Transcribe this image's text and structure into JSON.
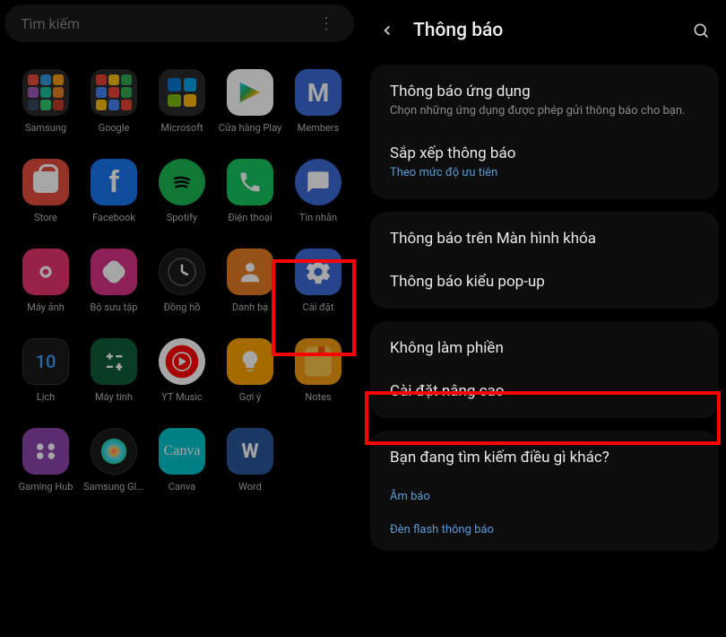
{
  "left": {
    "search_placeholder": "Tìm kiếm",
    "apps": [
      {
        "label": "Samsung",
        "icon": "folder",
        "colors": [
          "#e74c3c",
          "#3498db",
          "#f39c12",
          "#9b59b6",
          "#1abc9c",
          "#e67e22",
          "#34495e",
          "#2ecc71",
          "#c0392b"
        ]
      },
      {
        "label": "Google",
        "icon": "folder",
        "colors": [
          "#ea4335",
          "#fbbc05",
          "#34a853",
          "#4285f4",
          "#ea4335",
          "#34a853",
          "#fbbc05",
          "#4285f4",
          "#ea4335"
        ]
      },
      {
        "label": "Microsoft",
        "icon": "ms-folder",
        "colors": [
          "#0078d4",
          "#00a4ef",
          "#7fba00",
          "#ffb900"
        ]
      },
      {
        "label": "Cửa hàng Play",
        "icon": "play"
      },
      {
        "label": "Members",
        "icon": "members",
        "glyph": "M"
      },
      {
        "label": "Store",
        "icon": "store"
      },
      {
        "label": "Facebook",
        "icon": "fb",
        "glyph": "f"
      },
      {
        "label": "Spotify",
        "icon": "spotify"
      },
      {
        "label": "Điện thoại",
        "icon": "phone"
      },
      {
        "label": "Tin nhắn",
        "icon": "msg"
      },
      {
        "label": "Máy ảnh",
        "icon": "camera"
      },
      {
        "label": "Bộ sưu tập",
        "icon": "gallery"
      },
      {
        "label": "Đồng hồ",
        "icon": "clock"
      },
      {
        "label": "Danh bạ",
        "icon": "contacts"
      },
      {
        "label": "Cài đặt",
        "icon": "settings"
      },
      {
        "label": "Lịch",
        "icon": "calendar",
        "glyph": "10"
      },
      {
        "label": "Máy tính",
        "icon": "calc"
      },
      {
        "label": "YT Music",
        "icon": "ytmusic"
      },
      {
        "label": "Gợi ý",
        "icon": "tips"
      },
      {
        "label": "Notes",
        "icon": "notes"
      },
      {
        "label": "Gaming Hub",
        "icon": "gaming"
      },
      {
        "label": "Samsung Gl...",
        "icon": "globe"
      },
      {
        "label": "Canva",
        "icon": "canva",
        "glyph": "Canva"
      },
      {
        "label": "Word",
        "icon": "word",
        "glyph": "W"
      }
    ]
  },
  "right": {
    "title": "Thông báo",
    "groups": [
      [
        {
          "title": "Thông báo ứng dụng",
          "sub": "Chọn những ứng dụng được phép gửi thông báo cho bạn."
        },
        {
          "title": "Sắp xếp thông báo",
          "sub": "Theo mức độ ưu tiên",
          "link": true
        }
      ],
      [
        {
          "title": "Thông báo trên Màn hình khóa"
        },
        {
          "title": "Thông báo kiểu pop-up"
        }
      ],
      [
        {
          "title": "Không làm phiền"
        },
        {
          "title": "Cài đặt nâng cao"
        }
      ],
      [
        {
          "title": "Bạn đang tìm kiếm điều gì khác?"
        },
        {
          "title": "Âm báo",
          "link": true,
          "sub_only": true
        },
        {
          "title": "Đèn flash thông báo",
          "link": true,
          "sub_only": true
        }
      ]
    ]
  }
}
